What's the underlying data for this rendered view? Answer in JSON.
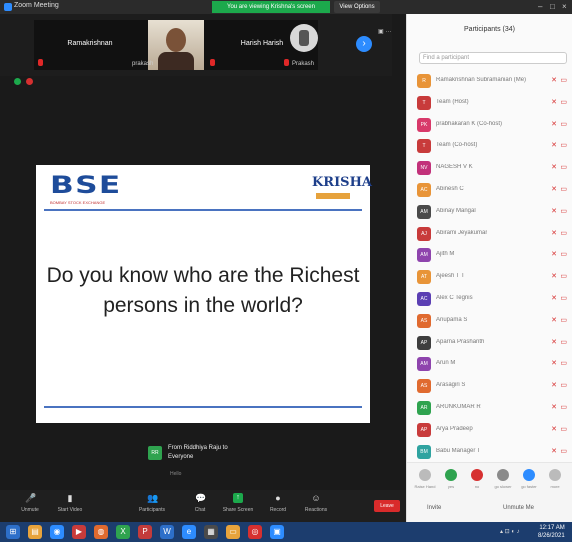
{
  "titlebar": {
    "app_title": "Zoom Meeting",
    "viewing_banner": "You are viewing Krishna's screen",
    "view_options": "View Options"
  },
  "video_tiles": [
    {
      "name": "Ramakrishnan",
      "label": "",
      "kind": "name"
    },
    {
      "name": "",
      "label": "prakash",
      "kind": "photo"
    },
    {
      "name": "Harish Harish",
      "label": "",
      "kind": "name"
    },
    {
      "name": "",
      "label": "Prakash",
      "kind": "avatar"
    }
  ],
  "slide": {
    "bse_logo": "BSE",
    "bse_subtitle": "BOMBAY STOCK EXCHANGE",
    "krisha_logo": "KRISHA",
    "headline_line1": "Do you know who are the Richest",
    "headline_line2": "persons in the world?"
  },
  "chat": {
    "avatar": "RR",
    "line1": "From Riddhiya Raju to",
    "line2": "Everyone",
    "sub": "Hello"
  },
  "toolbar": {
    "items": [
      {
        "icon": "mic-icon",
        "label": "Unmute"
      },
      {
        "icon": "video-icon",
        "label": "Start Video"
      },
      {
        "icon": "participants-icon",
        "label": "Participants"
      },
      {
        "icon": "chat-icon",
        "label": "Chat"
      },
      {
        "icon": "share-screen-icon",
        "label": "Share Screen"
      },
      {
        "icon": "record-icon",
        "label": "Record"
      },
      {
        "icon": "reactions-icon",
        "label": "Reactions"
      }
    ],
    "leave": "Leave"
  },
  "panel": {
    "title": "Participants (34)",
    "search_placeholder": "Find a participant",
    "participants": [
      {
        "initials": "R",
        "name": "Ramakrishnan Subramanian (Me)",
        "color": "#e89438"
      },
      {
        "initials": "T",
        "name": "Team (Host)",
        "color": "#c83b3b"
      },
      {
        "initials": "PK",
        "name": "prabhakaran K (Co-host)",
        "color": "#d8396a"
      },
      {
        "initials": "T",
        "name": "Team (Co-host)",
        "color": "#c83b3b"
      },
      {
        "initials": "NV",
        "name": "NAGESH V K",
        "color": "#c2317a"
      },
      {
        "initials": "AC",
        "name": "Abinesh C",
        "color": "#e89438"
      },
      {
        "initials": "AM",
        "name": "Abinay Mangal",
        "color": "#4a4a4a"
      },
      {
        "initials": "AJ",
        "name": "Abirami Jeyakumar",
        "color": "#c83b3b"
      },
      {
        "initials": "AM",
        "name": "Ajith M",
        "color": "#8e44ad"
      },
      {
        "initials": "AT",
        "name": "Ajeesh T T",
        "color": "#e89438"
      },
      {
        "initials": "AC",
        "name": "Alex C Tegnis",
        "color": "#5b3fb3"
      },
      {
        "initials": "AS",
        "name": "Anupama S",
        "color": "#e06a2f"
      },
      {
        "initials": "AP",
        "name": "Aparna Prashanth",
        "color": "#3e3e3e"
      },
      {
        "initials": "AM",
        "name": "Arun M",
        "color": "#8e44ad"
      },
      {
        "initials": "AS",
        "name": "Arasagiri S",
        "color": "#e06a2f"
      },
      {
        "initials": "AR",
        "name": "ARUNKUMAR R",
        "color": "#2fa34f"
      },
      {
        "initials": "AP",
        "name": "Arya Pradeep",
        "color": "#c83b3b"
      },
      {
        "initials": "BM",
        "name": "Babu Manager T",
        "color": "#2fa3a0"
      }
    ],
    "footer": [
      {
        "label": "Raise Hand",
        "color": "#bbbbbb"
      },
      {
        "label": "yes",
        "color": "#2fa34f"
      },
      {
        "label": "no",
        "color": "#d63030"
      },
      {
        "label": "go slower",
        "color": "#8a8a8a"
      },
      {
        "label": "go faster",
        "color": "#2d8cff"
      },
      {
        "label": "more",
        "color": "#bbbbbb"
      }
    ],
    "invite": "Invite",
    "mute_all": "Unmute Me"
  },
  "taskbar": {
    "clock_time": "12:17 AM",
    "clock_date": "8/26/2021"
  },
  "colors": {
    "zoom_blue": "#2d8cff",
    "banner_green": "#1ca94c",
    "leave_red": "#d92b2b"
  }
}
